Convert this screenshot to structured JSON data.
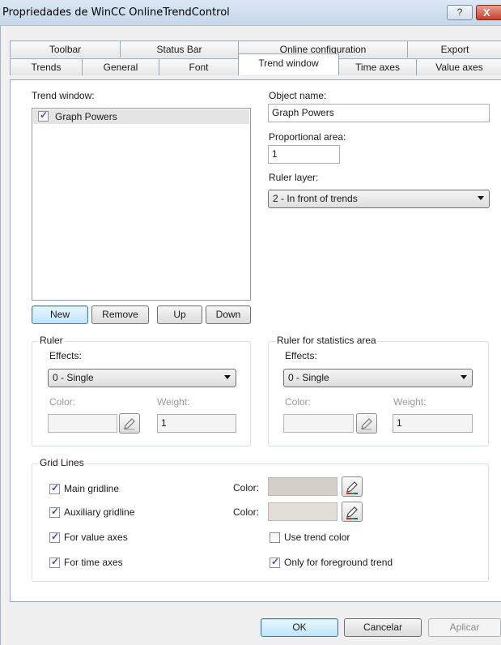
{
  "window": {
    "title": "Propriedades de WinCC OnlineTrendControl",
    "help_label": "?",
    "close_label": "X"
  },
  "tabs_row1": [
    "Toolbar",
    "Status Bar",
    "Online configuration",
    "Export"
  ],
  "tabs_row2": [
    "Trends",
    "General",
    "Font",
    "Trend window",
    "Time axes",
    "Value axes"
  ],
  "active_tab": "Trend window",
  "trend_window": {
    "list_label": "Trend window:",
    "items": [
      {
        "label": "Graph Powers",
        "checked": true
      }
    ],
    "object_name_label": "Object name:",
    "object_name_value": "Graph Powers",
    "proportional_area_label": "Proportional area:",
    "proportional_area_value": "1",
    "ruler_layer_label": "Ruler layer:",
    "ruler_layer_value": "2 - In front of trends"
  },
  "list_buttons": {
    "new": "New",
    "remove": "Remove",
    "up": "Up",
    "down": "Down"
  },
  "ruler": {
    "title": "Ruler",
    "effects_label": "Effects:",
    "effects_value": "0 - Single",
    "color_label": "Color:",
    "weight_label": "Weight:",
    "weight_value": "1"
  },
  "ruler_stats": {
    "title": "Ruler for statistics area",
    "effects_label": "Effects:",
    "effects_value": "0 - Single",
    "color_label": "Color:",
    "weight_label": "Weight:",
    "weight_value": "1"
  },
  "grid_lines": {
    "title": "Grid Lines",
    "main_gridline": "Main gridline",
    "auxiliary_gridline": "Auxiliary gridline",
    "for_value_axes": "For value axes",
    "for_time_axes": "For time axes",
    "color_label_1": "Color:",
    "color_label_2": "Color:",
    "use_trend_color": "Use trend color",
    "only_foreground": "Only for foreground trend",
    "main_gridline_checked": true,
    "auxiliary_gridline_checked": true,
    "for_value_axes_checked": true,
    "for_time_axes_checked": true,
    "use_trend_color_checked": false,
    "only_foreground_checked": true,
    "main_color": "#d4d0c8",
    "aux_color": "#e2ded6"
  },
  "footer": {
    "ok": "OK",
    "cancel": "Cancelar",
    "apply": "Aplicar"
  },
  "colors": {
    "accent": "#3c7fb1",
    "title_bar": "#c6d7ea",
    "close_button": "#c7402b",
    "check_mark": "#3a5a9a"
  }
}
